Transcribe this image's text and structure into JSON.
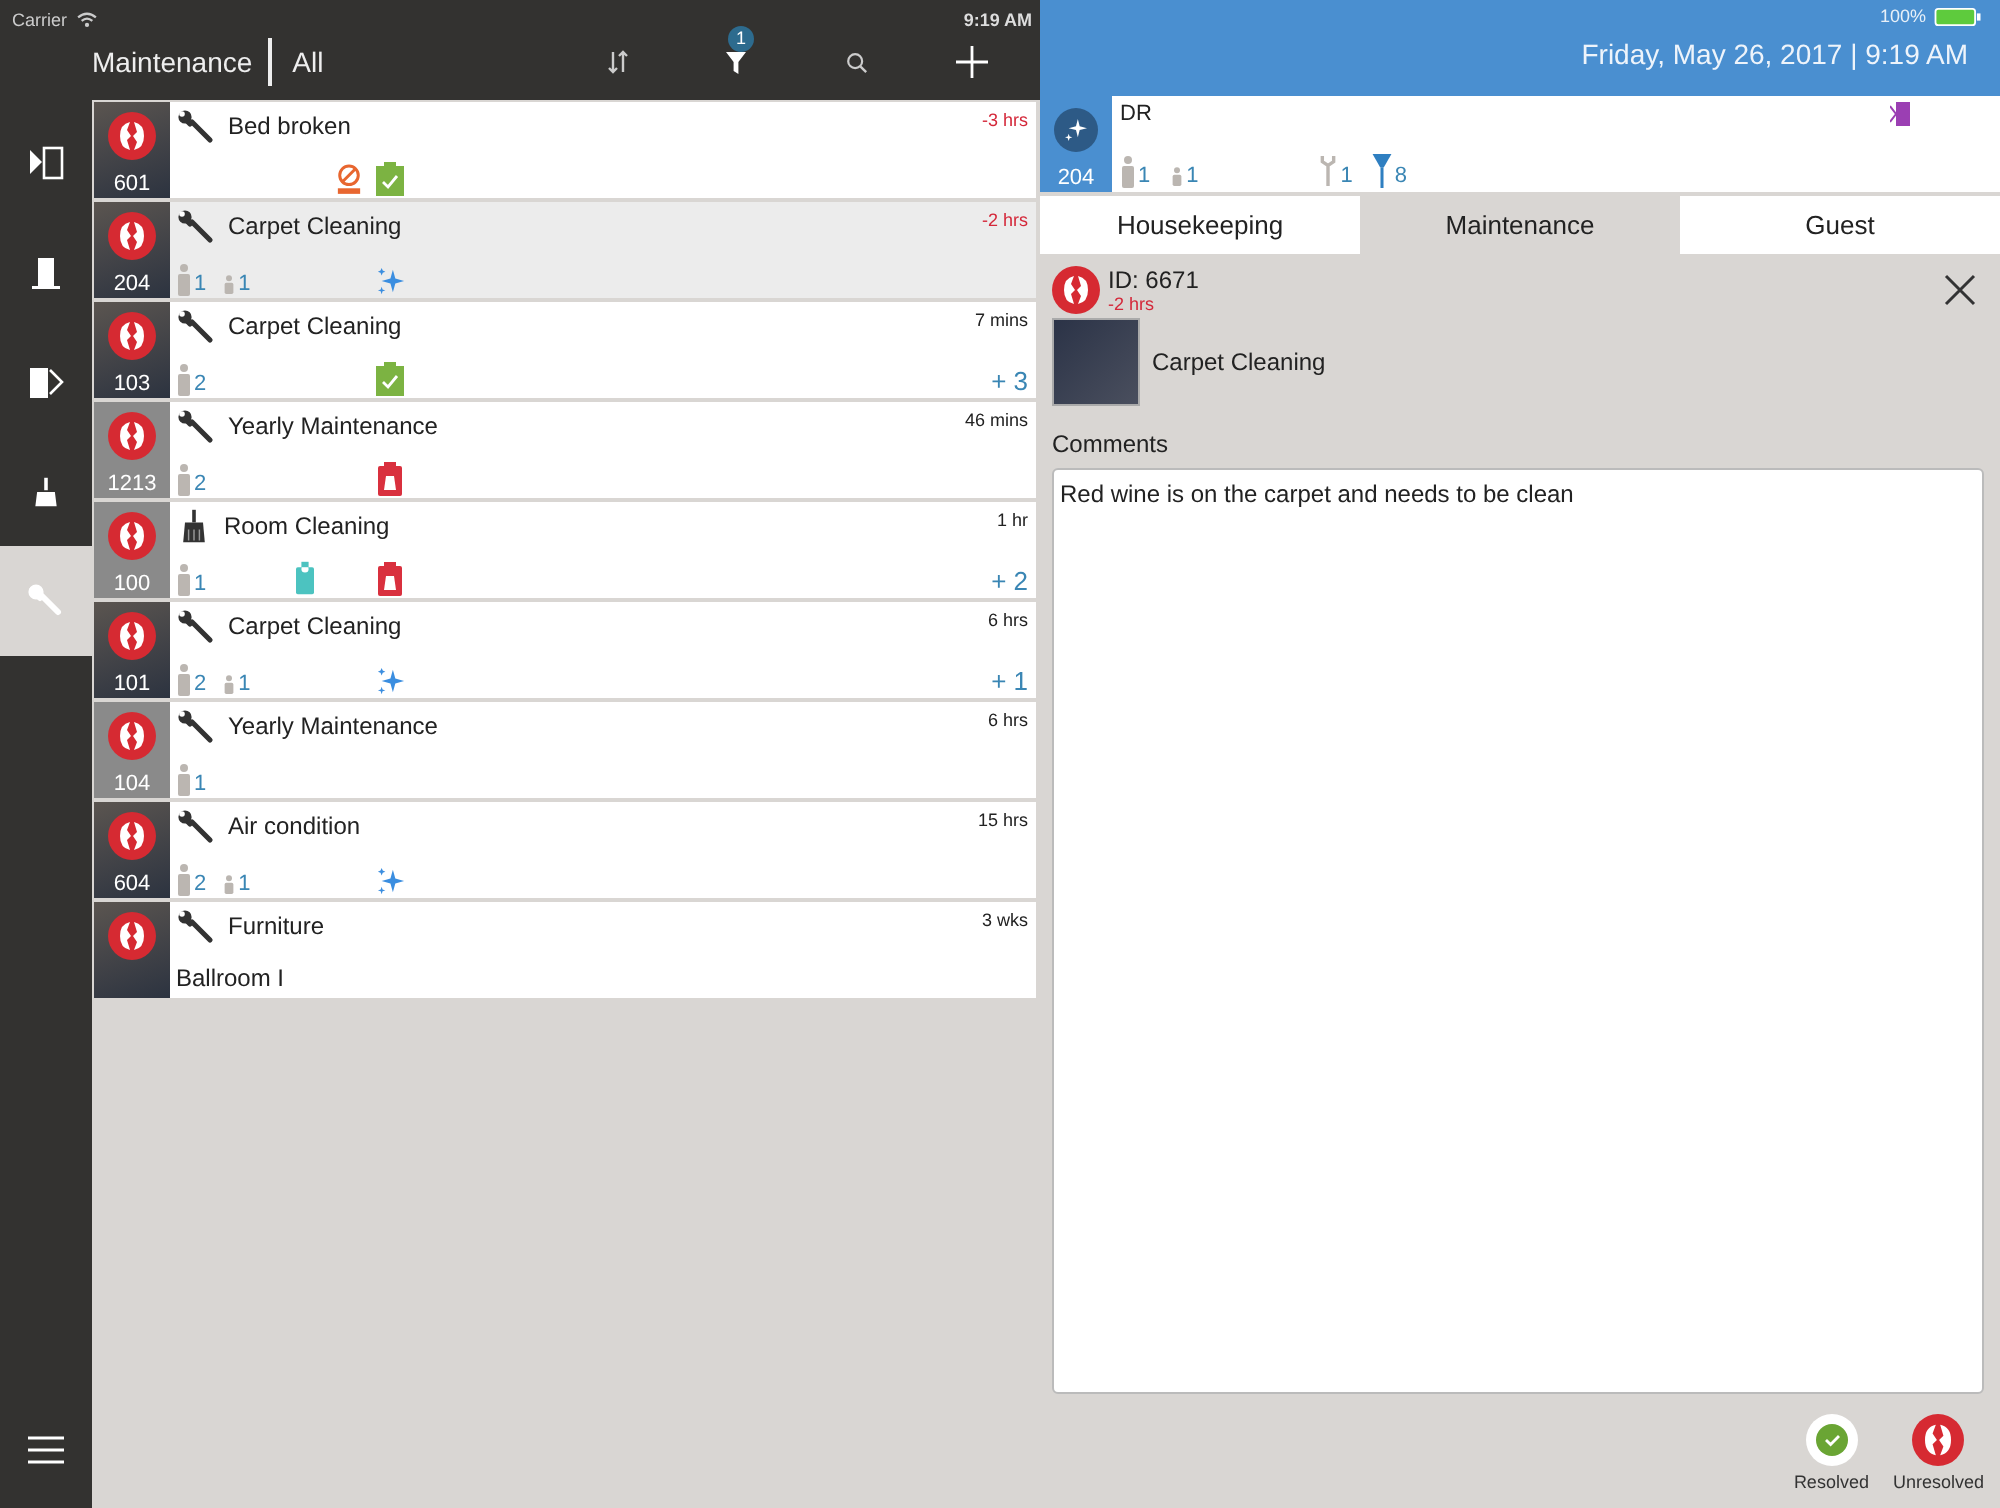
{
  "status_bar": {
    "carrier": "Carrier",
    "time": "9:19 AM",
    "battery": "100%"
  },
  "header": {
    "title": "Maintenance",
    "filter": "All",
    "filter_badge": "1"
  },
  "nav": [
    {
      "kind": "check-in",
      "selected": false
    },
    {
      "kind": "occupied",
      "selected": false
    },
    {
      "kind": "check-out",
      "selected": false
    },
    {
      "kind": "housekeeping",
      "selected": false
    },
    {
      "kind": "maintenance",
      "selected": true
    }
  ],
  "tasks": [
    {
      "room": "601",
      "photo": true,
      "kind": "wrench",
      "title": "Bed broken",
      "time": "-3 hrs",
      "overdue": true,
      "selected": false,
      "status": [
        {
          "kind": "dnd"
        },
        {
          "kind": "clipboard"
        }
      ]
    },
    {
      "room": "204",
      "photo": true,
      "kind": "wrench",
      "title": "Carpet Cleaning",
      "time": "-2 hrs",
      "overdue": true,
      "selected": true,
      "counts": [
        {
          "kind": "adult",
          "value": "1"
        },
        {
          "kind": "child",
          "value": "1"
        }
      ],
      "status": [
        {
          "kind": "sparkle"
        }
      ]
    },
    {
      "room": "103",
      "photo": true,
      "kind": "wrench",
      "title": "Carpet Cleaning",
      "time": "7 mins",
      "overdue": false,
      "selected": false,
      "counts": [
        {
          "kind": "adult",
          "value": "2"
        }
      ],
      "status": [
        {
          "kind": "clipboard"
        }
      ],
      "extra": "+ 3"
    },
    {
      "room": "1213",
      "photo": false,
      "kind": "wrench",
      "title": "Yearly Maintenance",
      "time": "46 mins",
      "overdue": false,
      "selected": false,
      "counts": [
        {
          "kind": "adult",
          "value": "2"
        }
      ],
      "status": [
        {
          "kind": "trash"
        }
      ]
    },
    {
      "room": "100",
      "photo": false,
      "kind": "broom",
      "title": "Room Cleaning",
      "time": "1 hr",
      "overdue": false,
      "selected": false,
      "counts": [
        {
          "kind": "adult",
          "value": "1"
        }
      ],
      "status": [
        {
          "kind": "tag"
        },
        {
          "kind": "trash"
        }
      ],
      "extra": "+ 2"
    },
    {
      "room": "101",
      "photo": true,
      "kind": "wrench",
      "title": "Carpet Cleaning",
      "time": "6 hrs",
      "overdue": false,
      "selected": false,
      "counts": [
        {
          "kind": "adult",
          "value": "2"
        },
        {
          "kind": "child",
          "value": "1"
        }
      ],
      "status": [
        {
          "kind": "sparkle"
        }
      ],
      "extra": "+ 1"
    },
    {
      "room": "104",
      "photo": false,
      "kind": "wrench",
      "title": "Yearly Maintenance",
      "time": "6 hrs",
      "overdue": false,
      "selected": false,
      "counts": [
        {
          "kind": "adult",
          "value": "1"
        }
      ]
    },
    {
      "room": "604",
      "photo": true,
      "kind": "wrench",
      "title": "Air condition",
      "time": "15 hrs",
      "overdue": false,
      "selected": false,
      "counts": [
        {
          "kind": "adult",
          "value": "2"
        },
        {
          "kind": "child",
          "value": "1"
        }
      ],
      "status": [
        {
          "kind": "sparkle"
        }
      ]
    },
    {
      "photo": true,
      "kind": "wrench",
      "title": "Furniture",
      "time": "3 wks",
      "overdue": false,
      "selected": false,
      "location": "Ballroom I"
    }
  ],
  "date": "Friday, May 26, 2017 | 9:19 AM",
  "room_card": {
    "room": "204",
    "status": "DR",
    "counts": [
      {
        "kind": "adult",
        "value": "1"
      },
      {
        "kind": "child",
        "value": "1"
      },
      {
        "kind": "wrench",
        "value": "1"
      },
      {
        "kind": "duster",
        "value": "8"
      }
    ]
  },
  "tabs": [
    {
      "label": "Housekeeping",
      "selected": false
    },
    {
      "label": "Maintenance",
      "selected": true
    },
    {
      "label": "Guest",
      "selected": false
    }
  ],
  "detail": {
    "id": "ID: 6671",
    "time": "-2 hrs",
    "title": "Carpet Cleaning",
    "comments_label": "Comments",
    "comment": "Red wine is on the carpet and needs to be clean"
  },
  "actions": [
    {
      "kind": "resolved",
      "label": "Resolved"
    },
    {
      "kind": "unresolved",
      "label": "Unresolved"
    }
  ]
}
